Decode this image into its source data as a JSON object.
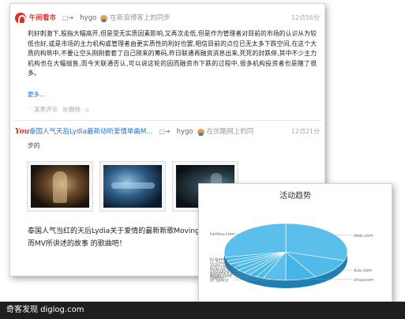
{
  "post1": {
    "source": "午间看市",
    "user": "hygo",
    "sync_text": "在新浪博客上的同步",
    "time": "12点56分",
    "body": "利好刺激下,股指大幅高开,但是受无实质因素影响,又再次走低,但是作为管理者对目前的市场的认识从为较低也好,或是市场的主力机构或管理者由更实质性的利好也罢,相信目前的点位已无太多下跌空间,在这个大质的构筑中,不要让空头刚刚套套了自己刚来的筹码,昨日联通再融资消息出来,死死的封跌停,其中不少主力机构也在大幅抛售,而今天联通否认,可以说这轮的因而融资市下跌的过程中,很多机构投资者也是瞎了很多。",
    "more": "更多...",
    "actions": [
      "发表评论",
      "删除"
    ]
  },
  "post2": {
    "source": "泰国人气天后Lydia最新动听爱情单曲M...",
    "user": "hygo",
    "sync_text": "在优酷网上的同",
    "time": "12点21分",
    "sub": "步的",
    "text": "泰国人气当红的天后Lydia关于爱情的最新新歌Moving 没关系，至少旋律还是非常动听的，而MV所讲述的故事 的歌曲吧！"
  },
  "chart": {
    "title": "活动趋势"
  },
  "chart_data": {
    "type": "pie",
    "title": "活动趋势",
    "labels": [
      "ikee.com",
      "dus.com",
      "chuucom",
      "ie Space",
      "Twitter",
      "Flickr.com",
      "baozha.com",
      "photolog",
      "kuai.com",
      "xiamuw.com",
      "Q-Zone",
      "hi.baidu",
      "tanfou.com"
    ],
    "values": [
      30,
      12,
      8,
      6,
      2,
      2,
      2,
      2,
      2,
      2,
      2,
      2,
      28
    ]
  },
  "watermark": {
    "text": "奇客发现 diglog.com"
  },
  "colors": {
    "accent_red": "#d9332b",
    "link_blue": "#2a6fc9",
    "pie_top": "#45b6e8",
    "pie_side": "#1f7fb3"
  }
}
